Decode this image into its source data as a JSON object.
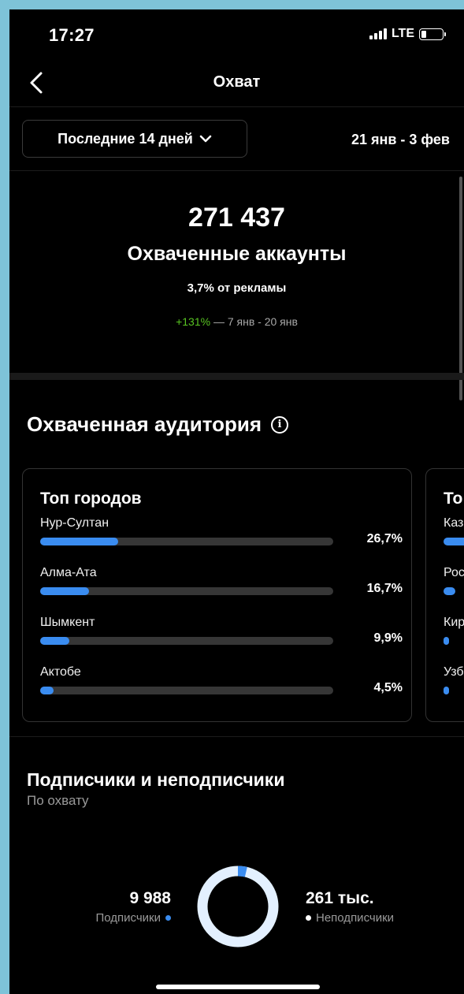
{
  "status": {
    "time": "17:27",
    "network": "LTE",
    "battery_level": 0.2
  },
  "nav": {
    "title": "Охват"
  },
  "filter": {
    "period_label": "Последние 14 дней",
    "date_range": "21 янв - 3 фев"
  },
  "reach": {
    "count": "271 437",
    "label": "Охваченные аккаунты",
    "ads_share": "3,7% от рекламы",
    "change_pct": "+131%",
    "change_period": " — 7 янв - 20 янв"
  },
  "audience": {
    "title": "Охваченная аудитория",
    "top_cities": {
      "title": "Топ городов",
      "items": [
        {
          "name": "Нур-Султан",
          "pct": "26,7%",
          "value": 26.7
        },
        {
          "name": "Алма-Ата",
          "pct": "16,7%",
          "value": 16.7
        },
        {
          "name": "Шымкент",
          "pct": "9,9%",
          "value": 9.9
        },
        {
          "name": "Актобе",
          "pct": "4,5%",
          "value": 4.5
        }
      ]
    },
    "next_card": {
      "title": "То",
      "items": [
        {
          "name": "Каз",
          "value": 60
        },
        {
          "name": "Рос",
          "value": 4
        },
        {
          "name": "Кир",
          "value": 2
        },
        {
          "name": "Узб",
          "value": 2
        }
      ]
    }
  },
  "followers": {
    "title": "Подписчики и неподписчики",
    "subtitle": "По охвату",
    "followers_value": "9 988",
    "followers_label": "Подписчики",
    "non_followers_value": "261 тыс.",
    "non_followers_label": "Неподписчики",
    "followers_share": 0.037,
    "colors": {
      "followers": "#3a8cf0",
      "non_followers": "#e3f0ff"
    }
  }
}
